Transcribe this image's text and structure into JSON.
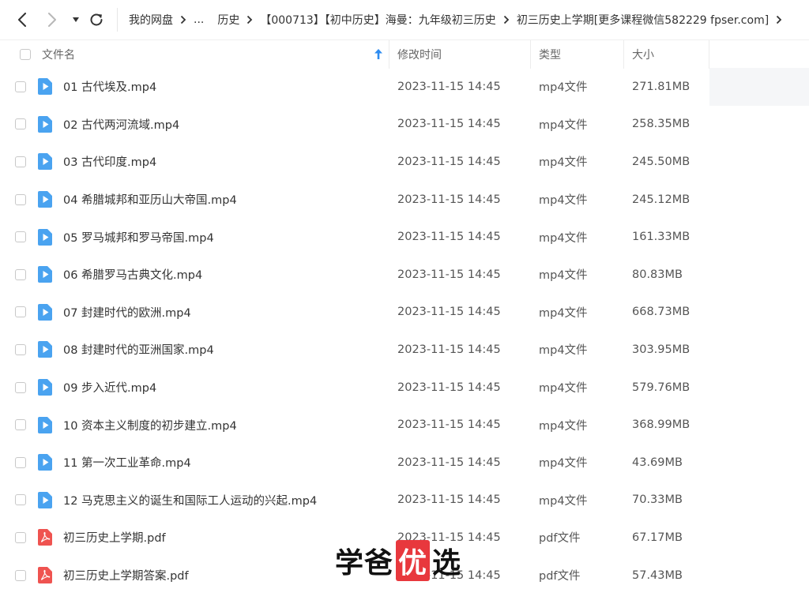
{
  "nav": {
    "breadcrumb": [
      "我的网盘",
      "...",
      "历史",
      "【000713】【初中历史】海曼：九年级初三历史",
      "初三历史上学期[更多课程微信582229 fpser.com]"
    ]
  },
  "header": {
    "name": "文件名",
    "time": "修改时间",
    "type": "类型",
    "size": "大小"
  },
  "files": [
    {
      "name": "01 古代埃及.mp4",
      "time": "2023-11-15 14:45",
      "type": "mp4文件",
      "size": "271.81MB",
      "icon": "video-file-icon"
    },
    {
      "name": "02 古代两河流域.mp4",
      "time": "2023-11-15 14:45",
      "type": "mp4文件",
      "size": "258.35MB",
      "icon": "video-file-icon"
    },
    {
      "name": "03 古代印度.mp4",
      "time": "2023-11-15 14:45",
      "type": "mp4文件",
      "size": "245.50MB",
      "icon": "video-file-icon"
    },
    {
      "name": "04 希腊城邦和亚历山大帝国.mp4",
      "time": "2023-11-15 14:45",
      "type": "mp4文件",
      "size": "245.12MB",
      "icon": "video-file-icon"
    },
    {
      "name": "05 罗马城邦和罗马帝国.mp4",
      "time": "2023-11-15 14:45",
      "type": "mp4文件",
      "size": "161.33MB",
      "icon": "video-file-icon"
    },
    {
      "name": "06 希腊罗马古典文化.mp4",
      "time": "2023-11-15 14:45",
      "type": "mp4文件",
      "size": "80.83MB",
      "icon": "video-file-icon"
    },
    {
      "name": "07 封建时代的欧洲.mp4",
      "time": "2023-11-15 14:45",
      "type": "mp4文件",
      "size": "668.73MB",
      "icon": "video-file-icon"
    },
    {
      "name": "08 封建时代的亚洲国家.mp4",
      "time": "2023-11-15 14:45",
      "type": "mp4文件",
      "size": "303.95MB",
      "icon": "video-file-icon"
    },
    {
      "name": "09 步入近代.mp4",
      "time": "2023-11-15 14:45",
      "type": "mp4文件",
      "size": "579.76MB",
      "icon": "video-file-icon"
    },
    {
      "name": "10 资本主义制度的初步建立.mp4",
      "time": "2023-11-15 14:45",
      "type": "mp4文件",
      "size": "368.99MB",
      "icon": "video-file-icon"
    },
    {
      "name": "11 第一次工业革命.mp4",
      "time": "2023-11-15 14:45",
      "type": "mp4文件",
      "size": "43.69MB",
      "icon": "video-file-icon"
    },
    {
      "name": "12 马克思主义的诞生和国际工人运动的兴起.mp4",
      "time": "2023-11-15 14:45",
      "type": "mp4文件",
      "size": "70.33MB",
      "icon": "video-file-icon"
    },
    {
      "name": "初三历史上学期.pdf",
      "time": "2023-11-15 14:45",
      "type": "pdf文件",
      "size": "67.17MB",
      "icon": "pdf-file-icon"
    },
    {
      "name": "初三历史上学期答案.pdf",
      "time": "2023-11-15 14:45",
      "type": "pdf文件",
      "size": "57.43MB",
      "icon": "pdf-file-icon"
    }
  ],
  "watermark": [
    "学",
    "爸",
    "优",
    "选"
  ],
  "colors": {
    "accent": "#2e8cf0",
    "video_icon": "#4aa3f0",
    "pdf_icon": "#ef5350",
    "watermark_accent": "#e8383d"
  }
}
